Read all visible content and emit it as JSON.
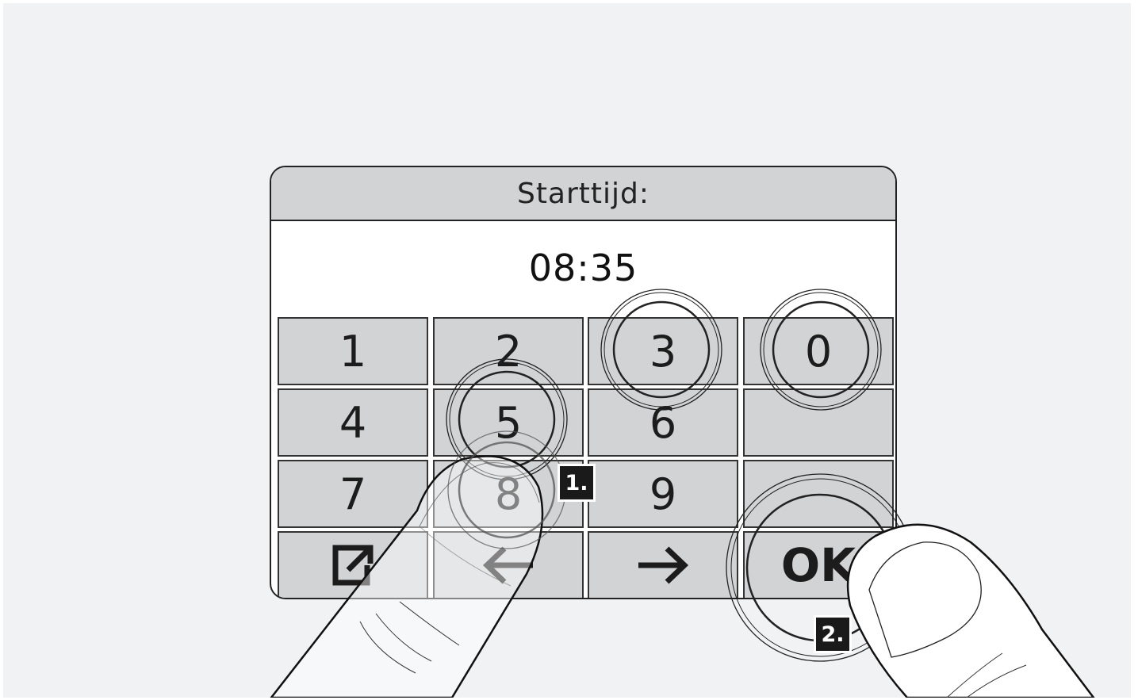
{
  "panel": {
    "title": "Starttijd:",
    "time_value": "08:35"
  },
  "keypad": {
    "keys": [
      {
        "label": "1"
      },
      {
        "label": "2"
      },
      {
        "label": "3"
      },
      {
        "label": "0"
      },
      {
        "label": "4"
      },
      {
        "label": "5"
      },
      {
        "label": "6"
      },
      {
        "label": ""
      },
      {
        "label": "7"
      },
      {
        "label": "8"
      },
      {
        "label": "9"
      },
      {
        "label": ""
      }
    ],
    "bottom_row": {
      "export_icon": "external-link-icon",
      "back_icon": "arrow-left-icon",
      "forward_icon": "arrow-right-icon",
      "ok_label": "OK"
    }
  },
  "steps": {
    "step1_label": "1.",
    "step2_label": "2."
  },
  "colors": {
    "background": "#f1f2f4",
    "key_fill": "#d2d3d5",
    "outline": "#222222"
  }
}
